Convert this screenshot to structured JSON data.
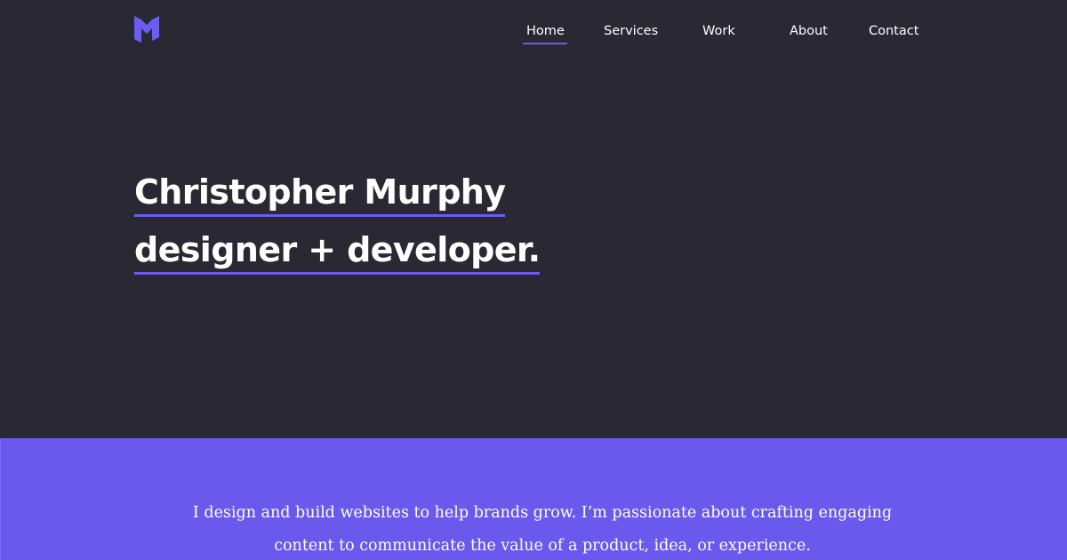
{
  "brand": {
    "logo_icon": "m-monogram-logo-icon",
    "accent_color": "#6c5cf0"
  },
  "nav": {
    "items": [
      {
        "label": "Home",
        "active": true
      },
      {
        "label": "Services",
        "active": false
      },
      {
        "label": "Work",
        "active": false
      },
      {
        "label": "About",
        "active": false
      },
      {
        "label": "Contact",
        "active": false
      }
    ]
  },
  "hero": {
    "name_line": "Christopher Murphy",
    "role_line": "designer + developer.",
    "background_color": "#2a2833"
  },
  "intro": {
    "text": "I design and build websites to help brands grow. I’m passionate about crafting engaging content to communicate the value of a product, idea, or experience.",
    "background_color": "#6b58ed"
  }
}
